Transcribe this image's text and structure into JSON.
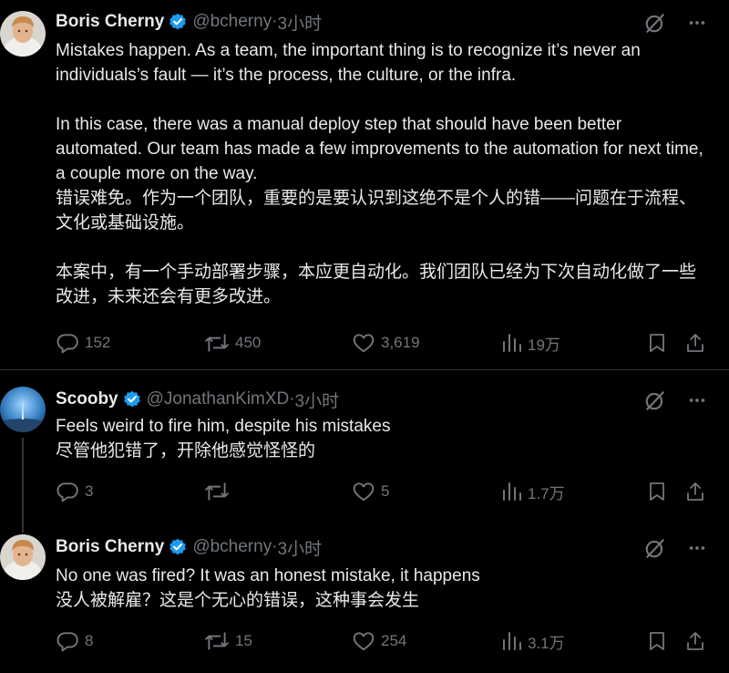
{
  "tweets": [
    {
      "author_name": "Boris Cherny",
      "handle": "@bcherny",
      "separator": "·",
      "time": "3小时",
      "text": "Mistakes happen. As a team, the important thing is to recognize it’s never an individuals’s fault — it’s the process, the culture, or the infra.\n\nIn this case, there was a manual deploy step that should have been better automated. Our team has made a few improvements to the automation for next time, a couple more on the way.\n错误难免。作为一个团队，重要的是要认识到这绝不是个人的错——问题在于流程、文化或基础设施。\n\n本案中，有一个手动部署步骤，本应更自动化。我们团队已经为下次自动化做了一些改进，未来还会有更多改进。",
      "replies": "152",
      "reposts": "450",
      "likes": "3,619",
      "views": "19万"
    },
    {
      "author_name": "Scooby",
      "handle": "@JonathanKimXD",
      "separator": "·",
      "time": "3小时",
      "text": "Feels weird to fire him, despite his mistakes\n尽管他犯错了，开除他感觉怪怪的",
      "replies": "3",
      "reposts": "",
      "likes": "5",
      "views": "1.7万"
    },
    {
      "author_name": "Boris Cherny",
      "handle": "@bcherny",
      "separator": "·",
      "time": "3小时",
      "text": "No one was fired? It was an honest mistake, it happens\n没人被解雇？这是个无心的错误，这种事会发生",
      "replies": "8",
      "reposts": "15",
      "likes": "254",
      "views": "3.1万"
    }
  ],
  "colors": {
    "background": "#000000",
    "text": "#e7e9ea",
    "muted": "#71767b",
    "verified": "#1d9bf0",
    "divider": "#2f3336"
  },
  "icons": [
    "grok-icon",
    "more-icon",
    "reply-icon",
    "repost-icon",
    "like-icon",
    "views-icon",
    "bookmark-icon",
    "share-icon",
    "verified-icon"
  ]
}
